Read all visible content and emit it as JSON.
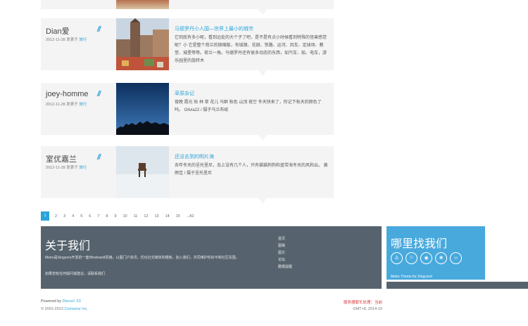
{
  "posts": [
    {
      "author": "Dian爱",
      "date": "2012-11-28 发表于",
      "category": "旅行",
      "title": "马德罗丹小人国—世界上最小的城市",
      "excerpt": "它到底有多小呢，看到远处的大个子了吧，是不是有点小时候看到特殊的怪兽感觉呢？小 它是整个荷兰的微缩版，有城镇、花田、铁路、运河、风车、足球场、教堂、城堡等等。荷兰一角。马德罗丹还有很多动态的东西，如汽车、船、电车，游乐园里的旋转木"
    },
    {
      "author": "joey-homme",
      "date": "2012-11-28 发表于",
      "category": "旅行",
      "title": "草原杂记",
      "excerpt": "夜晚 霞光 秋 林 草 花儿 马群 秋色 山顶 夜空 冬天快来了，你记下秋天的颜色了吗。 Olivia22 / 摄于乌兰布统"
    },
    {
      "author": "室优嘉兰",
      "date": "2012-11-28 发表于",
      "category": "旅行",
      "title": "还没去到的明片海",
      "excerpt": "去年冬天的呈托里尼，岛上没有几个人，只有猫猫狗狗和蓝带海冬天的风和云。 黄雨佳 / 摄于呈托里尼"
    }
  ],
  "quote_glyph": "//",
  "pagination": [
    "1",
    "2",
    "3",
    "4",
    "5",
    "6",
    "7",
    "8",
    "9",
    "10",
    "11",
    "12",
    "13",
    "14",
    "15",
    "...82"
  ],
  "about": {
    "title": "关于我们",
    "desc": "Metro是Singcere开发的一套Windows8风格，以图门户资讯，优化社交媒体的模板，加入我们，共同维护你好平和社区氛围。",
    "contact": "如果您有任何疑问或建议，请联系我们",
    "links": [
      "首页",
      "图稿",
      "图文",
      "论坛",
      "酷模提醒"
    ]
  },
  "find": {
    "title": "哪里找我们",
    "icons": [
      "qq-icon",
      "weibo-icon",
      "sina-weibo-icon",
      "qzone-icon",
      "wechat-icon"
    ],
    "icon_glyphs": [
      "♙",
      "⚐",
      "◉",
      "❀",
      "☺"
    ],
    "theme": "Metro Theme for Singcere!"
  },
  "footer": {
    "powered_prefix": "Powered by",
    "powered_link": "Discuz! X3",
    "copy_prefix": "© 2001-2013",
    "copy_link": "Comsenz Inc.",
    "warning": "服务器繁忙处理：当前",
    "gmt": "GMT+8, 2014-10"
  },
  "colors": {
    "accent": "#2ba3d9",
    "about_bg": "#56636e",
    "find_bg": "#48a9dd",
    "post_bg": "#f4f4f4"
  }
}
